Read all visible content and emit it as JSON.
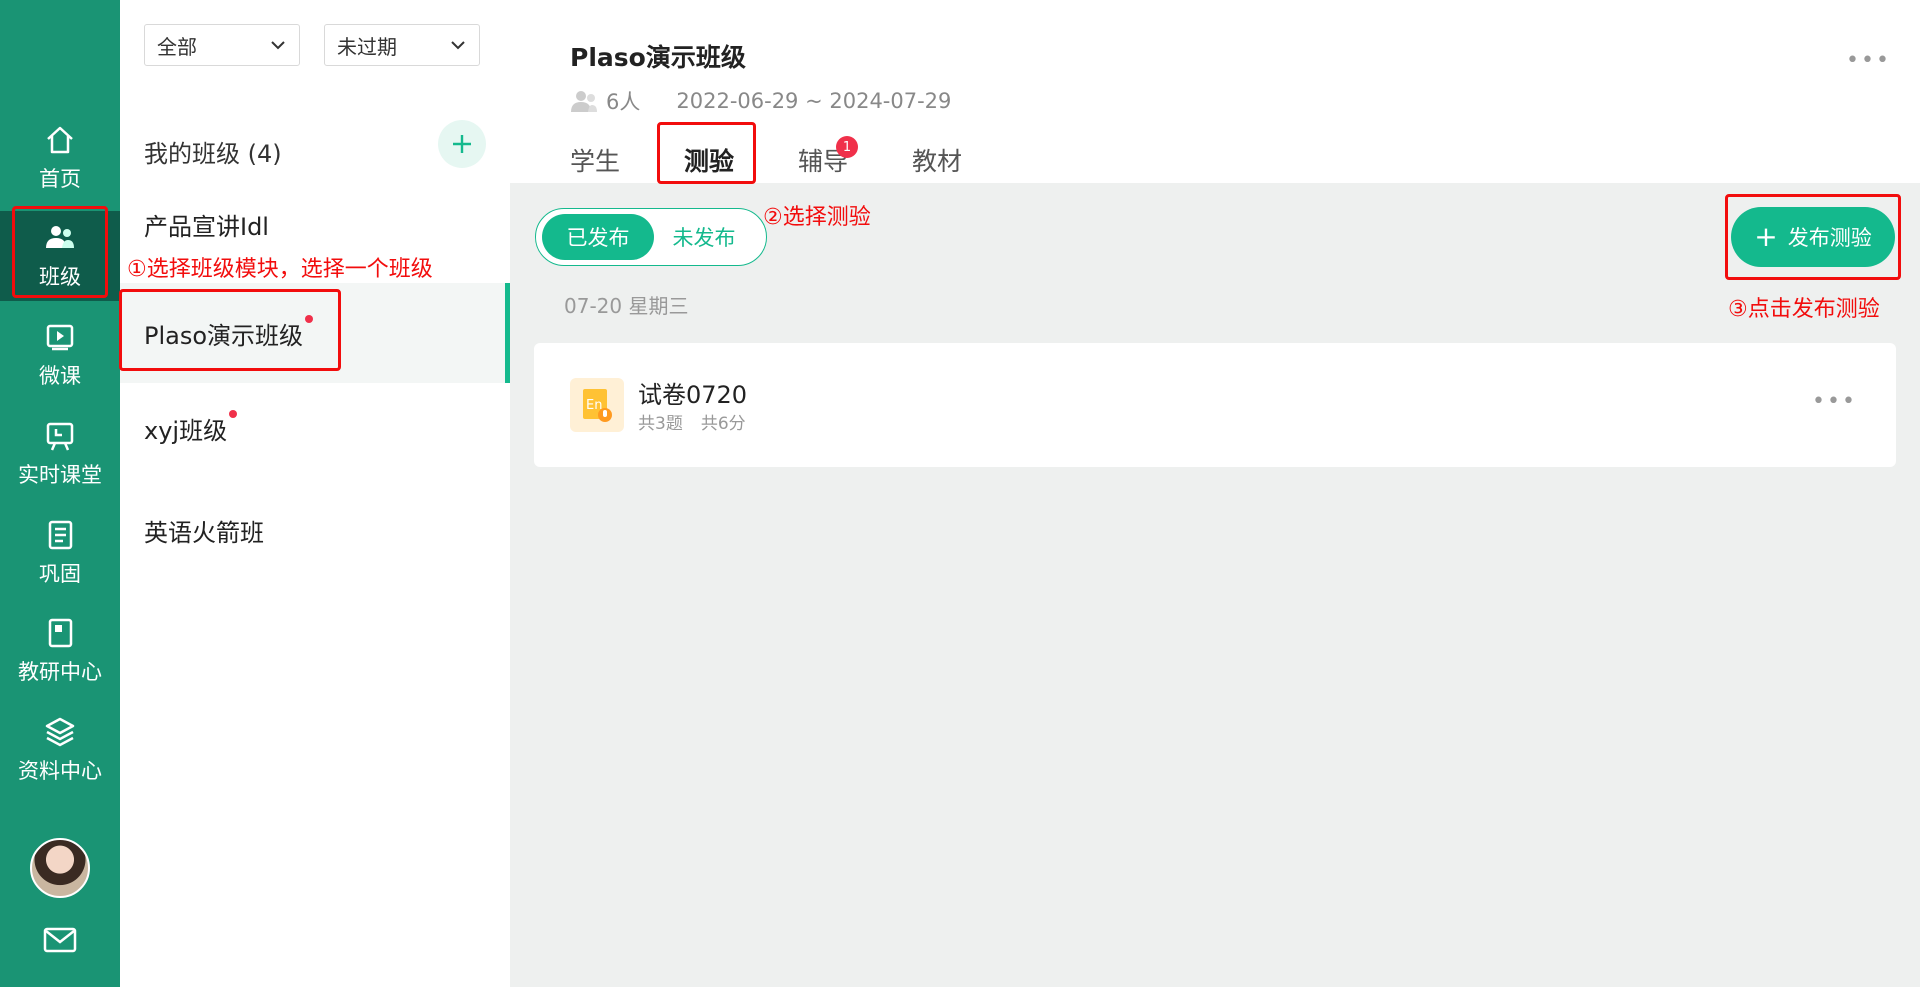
{
  "nav": {
    "items": [
      {
        "label": "首页",
        "icon": "home-icon"
      },
      {
        "label": "班级",
        "icon": "users-icon"
      },
      {
        "label": "微课",
        "icon": "video-icon"
      },
      {
        "label": "实时课堂",
        "icon": "board-icon"
      },
      {
        "label": "巩固",
        "icon": "notebook-icon"
      },
      {
        "label": "教研中心",
        "icon": "book-icon"
      },
      {
        "label": "资料中心",
        "icon": "layers-icon"
      }
    ],
    "active_index": 1,
    "mail_icon": "mail-icon"
  },
  "filters": {
    "scope": "全部",
    "status": "未过期"
  },
  "class_list": {
    "title": "我的班级 (4)",
    "items": [
      {
        "name": "产品宣讲Idl",
        "unread": false
      },
      {
        "name": "Plaso演示班级",
        "unread": true
      },
      {
        "name": "xyj班级",
        "unread": true
      },
      {
        "name": "英语火箭班",
        "unread": false
      }
    ],
    "selected_index": 1
  },
  "class_header": {
    "title": "Plaso演示班级",
    "members": "6人",
    "dates": "2022-06-29 ~ 2024-07-29",
    "tabs": [
      "学生",
      "测验",
      "辅导",
      "教材"
    ],
    "active_tab": 1,
    "tutoring_badge": "1"
  },
  "quiz": {
    "segments": [
      "已发布",
      "未发布"
    ],
    "active_segment": 0,
    "publish_label": "发布测验",
    "date_group": "07-20 星期三",
    "items": [
      {
        "title": "试卷0720",
        "questions": "共3题",
        "score": "共6分"
      }
    ]
  },
  "annotations": {
    "step1": "①选择班级模块，选择一个班级",
    "step2": "②选择测验",
    "step3": "③点击发布测验",
    "color": "#f20d0d"
  },
  "colors": {
    "rail": "#1a9474",
    "rail_active": "#0f5c4b",
    "accent": "#14b98d",
    "badge": "#f0304a"
  }
}
